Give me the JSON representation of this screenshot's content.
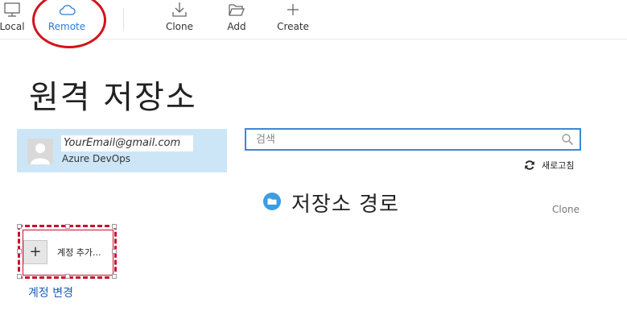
{
  "toolbar": {
    "local_label": "Local",
    "remote_label": "Remote",
    "clone_label": "Clone",
    "add_label": "Add",
    "create_label": "Create"
  },
  "page": {
    "title": "원격 저장소"
  },
  "account": {
    "email": "YourEmail@gmail.com",
    "provider": "Azure DevOps"
  },
  "search": {
    "placeholder": "검색"
  },
  "refresh_label": "새로고침",
  "repo_list": {
    "heading": "저장소 경로",
    "clone_column": "Clone"
  },
  "add_account_label": "계정 추가...",
  "change_account_label": "계정 변경",
  "colors": {
    "accent": "#2a7fd4",
    "card_bg": "#cde6f7",
    "highlight_red": "#d1141b"
  },
  "icons": {
    "local": "monitor-icon",
    "remote": "cloud-icon",
    "clone": "download-icon",
    "add": "folder-open-icon",
    "create": "plus-icon",
    "search": "search-icon",
    "refresh": "refresh-icon",
    "repo": "folder-icon",
    "avatar": "user-avatar-icon"
  }
}
